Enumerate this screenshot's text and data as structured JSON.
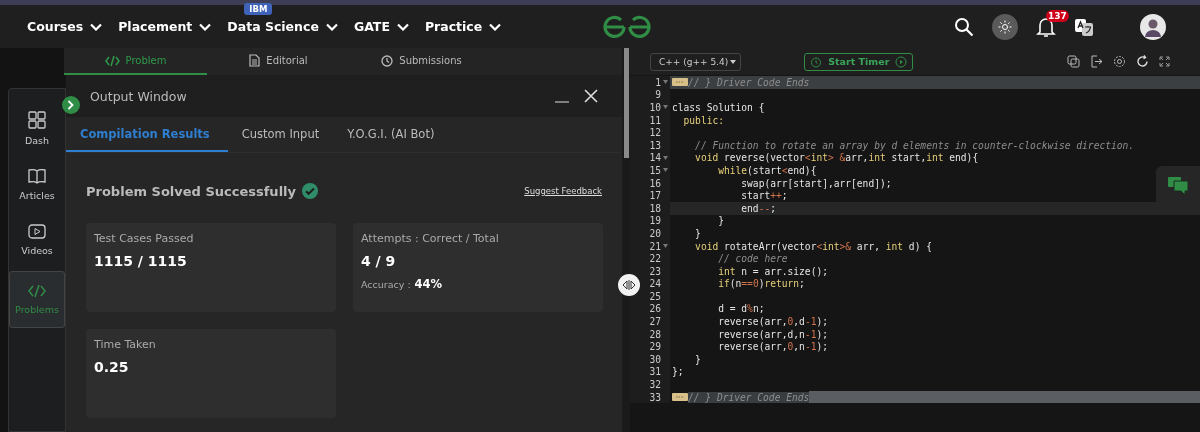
{
  "nav": {
    "items": [
      {
        "label": "Courses"
      },
      {
        "label": "Placement"
      },
      {
        "label": "Data Science",
        "badge": "IBM"
      },
      {
        "label": "GATE"
      },
      {
        "label": "Practice"
      }
    ],
    "notifications": "137"
  },
  "problem_tabs": [
    {
      "label": "Problem",
      "selected": true
    },
    {
      "label": "Editorial",
      "selected": false
    },
    {
      "label": "Submissions",
      "selected": false
    }
  ],
  "sidebar": [
    {
      "label": "Dash",
      "selected": false
    },
    {
      "label": "Articles",
      "selected": false
    },
    {
      "label": "Videos",
      "selected": false
    },
    {
      "label": "Problems",
      "selected": true
    }
  ],
  "output": {
    "title": "Output Window",
    "tabs": [
      {
        "label": "Compilation Results",
        "selected": true
      },
      {
        "label": "Custom Input",
        "selected": false
      },
      {
        "label": "Y.O.G.I. (AI Bot)",
        "selected": false
      }
    ],
    "status": "Problem Solved Successfully",
    "feedback": "Suggest Feedback",
    "cards": [
      {
        "label": "Test Cases Passed",
        "value": "1115 / 1115"
      },
      {
        "label": "Attempts : Correct / Total",
        "value": "4 / 9",
        "note_label": "Accuracy :",
        "note_value": "44%"
      },
      {
        "label": "Time Taken",
        "value": "0.25"
      }
    ]
  },
  "editor": {
    "language": "C++ (g++ 5.4)",
    "timer": "Start Timer",
    "lines": [
      {
        "num": "1",
        "foldable": true,
        "folded": true,
        "highlighted": true,
        "segs": [
          {
            "text": "// } Driver Code Ends",
            "kind": "comment"
          }
        ]
      },
      {
        "num": "9",
        "foldable": false,
        "folded": false,
        "highlighted": false
      },
      {
        "num": "10",
        "foldable": true,
        "folded": false,
        "highlighted": false,
        "segs": [
          {
            "text": "class Solution {",
            "kind": "plain"
          }
        ]
      },
      {
        "num": "11",
        "foldable": false,
        "folded": false,
        "highlighted": false,
        "segs": [
          {
            "text": "  public:",
            "kind": "kw"
          }
        ]
      },
      {
        "num": "12",
        "foldable": false,
        "folded": false,
        "highlighted": false
      },
      {
        "num": "13",
        "foldable": false,
        "folded": false,
        "highlighted": false,
        "segs": [
          {
            "text": "    // Function to rotate an array by d elements in counter-clockwise direction.",
            "kind": "comment"
          }
        ]
      },
      {
        "num": "14",
        "foldable": true,
        "folded": false,
        "highlighted": false,
        "segs": [
          {
            "text": "    void",
            "kind": "kw"
          },
          {
            "text": " reverse(vector",
            "kind": "plain"
          },
          {
            "text": "<",
            "kind": "op"
          },
          {
            "text": "int",
            "kind": "kw"
          },
          {
            "text": "> &",
            "kind": "op"
          },
          {
            "text": "arr,",
            "kind": "plain"
          },
          {
            "text": "int",
            "kind": "kw"
          },
          {
            "text": " start,",
            "kind": "plain"
          },
          {
            "text": "int",
            "kind": "kw"
          },
          {
            "text": " end){",
            "kind": "plain"
          }
        ]
      },
      {
        "num": "15",
        "foldable": true,
        "folded": false,
        "highlighted": false,
        "segs": [
          {
            "text": "        while",
            "kind": "kw"
          },
          {
            "text": "(start",
            "kind": "plain"
          },
          {
            "text": "<",
            "kind": "op"
          },
          {
            "text": "end){",
            "kind": "plain"
          }
        ]
      },
      {
        "num": "16",
        "foldable": false,
        "folded": false,
        "highlighted": false,
        "segs": [
          {
            "text": "            swap(arr[start],arr[end]);",
            "kind": "plain"
          }
        ]
      },
      {
        "num": "17",
        "foldable": false,
        "folded": false,
        "highlighted": false,
        "segs": [
          {
            "text": "            start",
            "kind": "plain"
          },
          {
            "text": "++",
            "kind": "op"
          },
          {
            "text": ";",
            "kind": "plain"
          }
        ]
      },
      {
        "num": "18",
        "foldable": false,
        "folded": false,
        "highlighted": true,
        "segs": [
          {
            "text": "            end",
            "kind": "plain"
          },
          {
            "text": "--",
            "kind": "op"
          },
          {
            "text": ";",
            "kind": "plain"
          }
        ]
      },
      {
        "num": "19",
        "foldable": false,
        "folded": false,
        "highlighted": false,
        "segs": [
          {
            "text": "        }",
            "kind": "plain"
          }
        ]
      },
      {
        "num": "20",
        "foldable": false,
        "folded": false,
        "highlighted": false,
        "segs": [
          {
            "text": "    }",
            "kind": "plain"
          }
        ]
      },
      {
        "num": "21",
        "foldable": true,
        "folded": false,
        "highlighted": false,
        "segs": [
          {
            "text": "    void",
            "kind": "kw"
          },
          {
            "text": " rotateArr(vector",
            "kind": "plain"
          },
          {
            "text": "<",
            "kind": "op"
          },
          {
            "text": "int",
            "kind": "kw"
          },
          {
            "text": ">&",
            "kind": "op"
          },
          {
            "text": " arr, ",
            "kind": "plain"
          },
          {
            "text": "int",
            "kind": "kw"
          },
          {
            "text": " d) {",
            "kind": "plain"
          }
        ]
      },
      {
        "num": "22",
        "foldable": false,
        "folded": false,
        "highlighted": false,
        "segs": [
          {
            "text": "        // code here",
            "kind": "comment"
          }
        ]
      },
      {
        "num": "23",
        "foldable": false,
        "folded": false,
        "highlighted": false,
        "segs": [
          {
            "text": "        int",
            "kind": "kw"
          },
          {
            "text": " n = arr.size();",
            "kind": "plain"
          }
        ]
      },
      {
        "num": "24",
        "foldable": false,
        "folded": false,
        "highlighted": false,
        "segs": [
          {
            "text": "        if",
            "kind": "kw"
          },
          {
            "text": "(n",
            "kind": "plain"
          },
          {
            "text": "==",
            "kind": "op"
          },
          {
            "text": "0",
            "kind": "num"
          },
          {
            "text": ")",
            "kind": "plain"
          },
          {
            "text": "return",
            "kind": "kw"
          },
          {
            "text": ";",
            "kind": "plain"
          }
        ]
      },
      {
        "num": "25",
        "foldable": false,
        "folded": false,
        "highlighted": false
      },
      {
        "num": "26",
        "foldable": false,
        "folded": false,
        "highlighted": false,
        "segs": [
          {
            "text": "        d = d",
            "kind": "plain"
          },
          {
            "text": "%",
            "kind": "op"
          },
          {
            "text": "n;",
            "kind": "plain"
          }
        ]
      },
      {
        "num": "27",
        "foldable": false,
        "folded": false,
        "highlighted": false,
        "segs": [
          {
            "text": "        reverse(arr,",
            "kind": "plain"
          },
          {
            "text": "0",
            "kind": "num"
          },
          {
            "text": ",d",
            "kind": "plain"
          },
          {
            "text": "-",
            "kind": "op"
          },
          {
            "text": "1",
            "kind": "num"
          },
          {
            "text": ");",
            "kind": "plain"
          }
        ]
      },
      {
        "num": "28",
        "foldable": false,
        "folded": false,
        "highlighted": false,
        "segs": [
          {
            "text": "        reverse(arr,d,n",
            "kind": "plain"
          },
          {
            "text": "-",
            "kind": "op"
          },
          {
            "text": "1",
            "kind": "num"
          },
          {
            "text": ");",
            "kind": "plain"
          }
        ]
      },
      {
        "num": "29",
        "foldable": false,
        "folded": false,
        "highlighted": false,
        "segs": [
          {
            "text": "        reverse(arr,",
            "kind": "plain"
          },
          {
            "text": "0",
            "kind": "num"
          },
          {
            "text": ",n",
            "kind": "plain"
          },
          {
            "text": "-",
            "kind": "op"
          },
          {
            "text": "1",
            "kind": "num"
          },
          {
            "text": ");",
            "kind": "plain"
          }
        ]
      },
      {
        "num": "30",
        "foldable": false,
        "folded": false,
        "highlighted": false,
        "segs": [
          {
            "text": "    }",
            "kind": "plain"
          }
        ]
      },
      {
        "num": "31",
        "foldable": false,
        "folded": false,
        "highlighted": false,
        "segs": [
          {
            "text": "};",
            "kind": "plain"
          }
        ]
      },
      {
        "num": "32",
        "foldable": false,
        "folded": false,
        "highlighted": false
      },
      {
        "num": "33",
        "foldable": false,
        "folded": true,
        "highlighted": false,
        "selected": true,
        "segs": [
          {
            "text": "// } Driver Code Ends",
            "kind": "comment"
          }
        ]
      }
    ]
  }
}
